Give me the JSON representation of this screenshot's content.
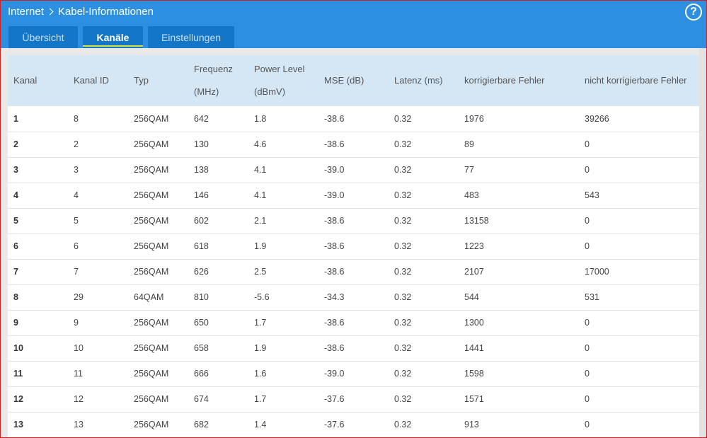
{
  "breadcrumb": {
    "section": "Internet",
    "page": "Kabel-Informationen"
  },
  "help_label": "?",
  "tabs": [
    {
      "label": "Übersicht",
      "active": false
    },
    {
      "label": "Kanäle",
      "active": true
    },
    {
      "label": "Einstellungen",
      "active": false
    }
  ],
  "colors": {
    "header": "#2d8fe0",
    "tab": "#1476c6",
    "tab_active_underline": "#d8e33a",
    "table_header": "#d5e7f5"
  },
  "table": {
    "headers": {
      "kanal": "Kanal",
      "kanal_id": "Kanal ID",
      "typ": "Typ",
      "frequenz_1": "Frequenz",
      "frequenz_2": "(MHz)",
      "power_1": "Power Level",
      "power_2": "(dBmV)",
      "mse": "MSE (dB)",
      "latenz": "Latenz (ms)",
      "korr": "korrigierbare Fehler",
      "nicht_korr": "nicht korrigierbare Fehler"
    },
    "rows": [
      [
        "1",
        "8",
        "256QAM",
        "642",
        "1.8",
        "-38.6",
        "0.32",
        "1976",
        "39266"
      ],
      [
        "2",
        "2",
        "256QAM",
        "130",
        "4.6",
        "-38.6",
        "0.32",
        "89",
        "0"
      ],
      [
        "3",
        "3",
        "256QAM",
        "138",
        "4.1",
        "-39.0",
        "0.32",
        "77",
        "0"
      ],
      [
        "4",
        "4",
        "256QAM",
        "146",
        "4.1",
        "-39.0",
        "0.32",
        "483",
        "543"
      ],
      [
        "5",
        "5",
        "256QAM",
        "602",
        "2.1",
        "-38.6",
        "0.32",
        "13158",
        "0"
      ],
      [
        "6",
        "6",
        "256QAM",
        "618",
        "1.9",
        "-38.6",
        "0.32",
        "1223",
        "0"
      ],
      [
        "7",
        "7",
        "256QAM",
        "626",
        "2.5",
        "-38.6",
        "0.32",
        "2107",
        "17000"
      ],
      [
        "8",
        "29",
        "64QAM",
        "810",
        "-5.6",
        "-34.3",
        "0.32",
        "544",
        "531"
      ],
      [
        "9",
        "9",
        "256QAM",
        "650",
        "1.7",
        "-38.6",
        "0.32",
        "1300",
        "0"
      ],
      [
        "10",
        "10",
        "256QAM",
        "658",
        "1.9",
        "-38.6",
        "0.32",
        "1441",
        "0"
      ],
      [
        "11",
        "11",
        "256QAM",
        "666",
        "1.6",
        "-39.0",
        "0.32",
        "1598",
        "0"
      ],
      [
        "12",
        "12",
        "256QAM",
        "674",
        "1.7",
        "-37.6",
        "0.32",
        "1571",
        "0"
      ],
      [
        "13",
        "13",
        "256QAM",
        "682",
        "1.4",
        "-37.6",
        "0.32",
        "913",
        "0"
      ]
    ]
  }
}
